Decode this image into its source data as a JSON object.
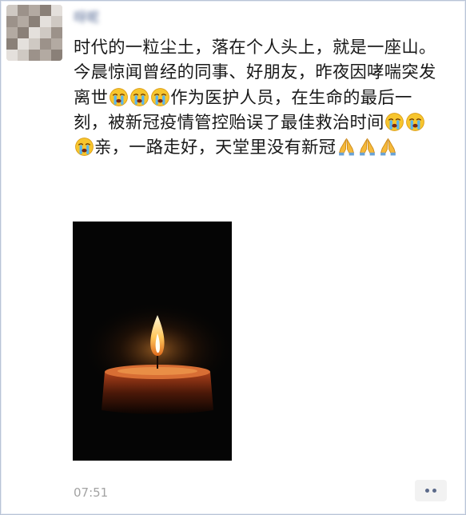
{
  "post": {
    "author_name": "呀呢",
    "text_segments": [
      {
        "type": "text",
        "value": "时代的一粒尘土，落在个人头上，就是一座山。今晨惊闻曾经的同事、好朋友，昨夜因哮喘突发离世"
      },
      {
        "type": "emoji",
        "icon": "crying-face-icon"
      },
      {
        "type": "emoji",
        "icon": "crying-face-icon"
      },
      {
        "type": "emoji",
        "icon": "crying-face-icon"
      },
      {
        "type": "text",
        "value": "作为医护人员，在生命的最后一刻，被新冠疫情管控贻误了最佳救治时间"
      },
      {
        "type": "emoji",
        "icon": "crying-face-icon"
      },
      {
        "type": "emoji",
        "icon": "crying-face-icon"
      },
      {
        "type": "emoji",
        "icon": "crying-face-icon"
      },
      {
        "type": "text",
        "value": "亲，一路走好，天堂里没有新冠"
      },
      {
        "type": "emoji",
        "icon": "praying-hands-icon"
      },
      {
        "type": "emoji",
        "icon": "praying-hands-icon"
      },
      {
        "type": "emoji",
        "icon": "praying-hands-icon"
      }
    ],
    "image": {
      "subject": "candle-flame-image"
    },
    "timestamp": "07:51",
    "more_button_icon": "more-dots-icon"
  },
  "colors": {
    "author_name": "#576b95",
    "text": "#191919",
    "timestamp": "#a3a3a3",
    "more_button_bg": "#f2f2f2",
    "more_button_dots": "#5b6a8a",
    "photo_bg": "#050505"
  }
}
